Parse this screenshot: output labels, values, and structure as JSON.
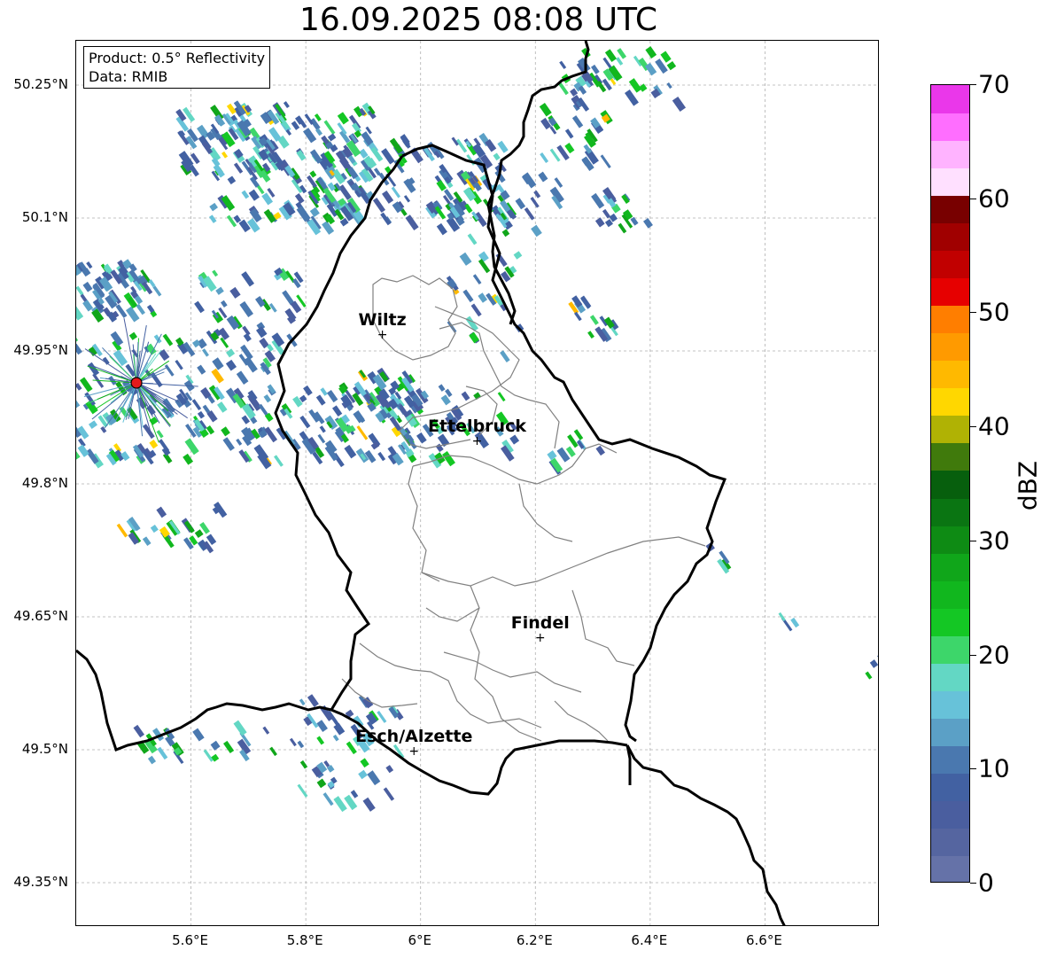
{
  "title": "16.09.2025 08:08 UTC",
  "info_box": {
    "product": "Product: 0.5° Reflectivity",
    "data": "Data: RMIB"
  },
  "map": {
    "lon_range": [
      5.4,
      6.8
    ],
    "lat_range": [
      49.3,
      50.3
    ],
    "lat_ticks": [
      {
        "value": 50.25,
        "label": "50.25°N"
      },
      {
        "value": 50.1,
        "label": "50.1°N"
      },
      {
        "value": 49.95,
        "label": "49.95°N"
      },
      {
        "value": 49.8,
        "label": "49.8°N"
      },
      {
        "value": 49.65,
        "label": "49.65°N"
      },
      {
        "value": 49.5,
        "label": "49.5°N"
      },
      {
        "value": 49.35,
        "label": "49.35°N"
      }
    ],
    "lon_ticks": [
      {
        "value": 5.6,
        "label": "5.6°E"
      },
      {
        "value": 5.8,
        "label": "5.8°E"
      },
      {
        "value": 6.0,
        "label": "6°E"
      },
      {
        "value": 6.2,
        "label": "6.2°E"
      },
      {
        "value": 6.4,
        "label": "6.4°E"
      },
      {
        "value": 6.6,
        "label": "6.6°E"
      }
    ],
    "radar_site": {
      "lon": 5.505,
      "lat": 49.914,
      "color": "#e41a1c"
    },
    "cities": [
      {
        "name": "Wiltz",
        "lon": 5.935,
        "lat": 49.967
      },
      {
        "name": "Ettelbruck",
        "lon": 6.1,
        "lat": 49.847
      },
      {
        "name": "Findel",
        "lon": 6.21,
        "lat": 49.625
      },
      {
        "name": "Esch/Alzette",
        "lon": 5.99,
        "lat": 49.497
      }
    ]
  },
  "colorbar": {
    "label": "dBZ",
    "min": 0,
    "max": 70,
    "ticks": [
      {
        "value": 0,
        "label": "0"
      },
      {
        "value": 10,
        "label": "10"
      },
      {
        "value": 20,
        "label": "20"
      },
      {
        "value": 30,
        "label": "30"
      },
      {
        "value": 40,
        "label": "40"
      },
      {
        "value": 50,
        "label": "50"
      },
      {
        "value": 60,
        "label": "60"
      },
      {
        "value": 70,
        "label": "70"
      }
    ],
    "colors": [
      "#6572a8",
      "#5565a0",
      "#4a5e9f",
      "#4261a2",
      "#4a78af",
      "#5ba0c6",
      "#67c2d9",
      "#63d7c4",
      "#3dd66a",
      "#14c724",
      "#11b71e",
      "#10a61a",
      "#0e8b14",
      "#0a7512",
      "#075f0d",
      "#407a0c",
      "#b0b204",
      "#ffd700",
      "#ffb900",
      "#ff9a00",
      "#ff7e00",
      "#e60000",
      "#c10000",
      "#a00000",
      "#780000",
      "#ffe0ff",
      "#ffb3ff",
      "#ff6eff",
      "#ea37ea"
    ]
  }
}
